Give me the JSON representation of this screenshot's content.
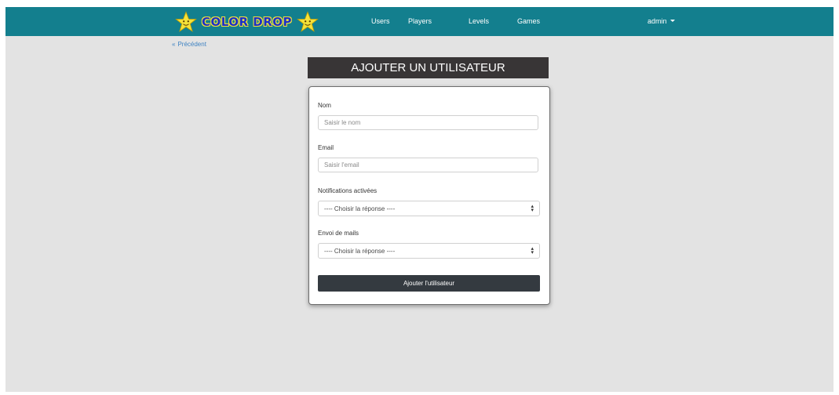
{
  "brand": {
    "name": "COLOR DROP",
    "star_color": "#f4e23a",
    "text_color": "#1a2fc9"
  },
  "nav": {
    "items": [
      "Users",
      "Players",
      "Levels",
      "Games"
    ],
    "user_menu": "admin"
  },
  "back_link": "Précédent",
  "form": {
    "title": "AJOUTER UN UTILISATEUR",
    "name_label": "Nom",
    "name_placeholder": "Saisir le nom",
    "email_label": "Email",
    "email_placeholder": "Saisir l'email",
    "notifications_label": "Notifications activées",
    "notifications_value": "---- Choisir la réponse ----",
    "mails_label": "Envoi de mails",
    "mails_value": "---- Choisir la réponse ----",
    "submit_label": "Ajouter l'utilisateur"
  },
  "colors": {
    "navbar": "#137f8e",
    "title_bar": "#383536",
    "submit": "#343a40",
    "link": "#3f83c2",
    "background": "#e3e3e3"
  }
}
